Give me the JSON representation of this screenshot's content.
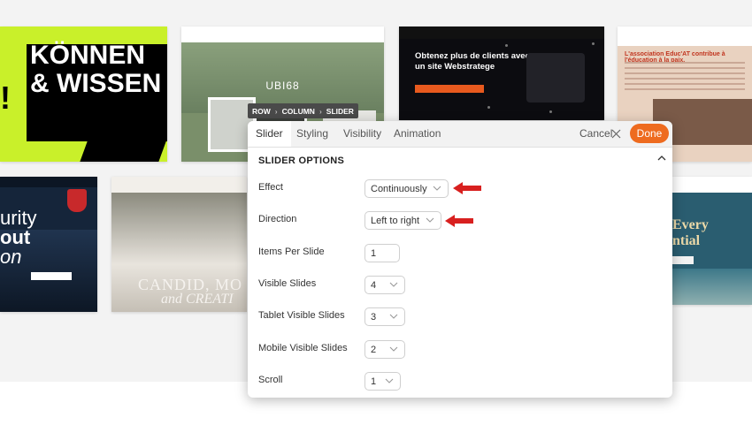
{
  "background": {
    "thumbnails": {
      "konnen": {
        "line1": "KÖNNEN",
        "line2": "& WISSEN",
        "mark": "!"
      },
      "ubi": {
        "logo": "UBI68"
      },
      "webstrat": {
        "headline": "Obtenez plus de clients avec un site Webstratege"
      },
      "educat": {
        "title": "L'association Educ'AT contribue à l'éducation à la paix."
      },
      "security": {
        "line1": "urity",
        "line2": "out",
        "line3": "on"
      },
      "wedding": {
        "line1": "CANDID, MO",
        "line2": "and CREATI"
      },
      "finance": {
        "line1": "Every",
        "line2": "ntial"
      }
    }
  },
  "breadcrumb": {
    "items": [
      "ROW",
      "COLUMN",
      "SLIDER"
    ],
    "separator": "›"
  },
  "panel": {
    "tabs": [
      {
        "label": "Slider",
        "active": true
      },
      {
        "label": "Styling",
        "active": false
      },
      {
        "label": "Visibility",
        "active": false
      },
      {
        "label": "Animation",
        "active": false
      }
    ],
    "cancel_label": "Cancel",
    "done_label": "Done",
    "section_title": "SLIDER OPTIONS",
    "fields": {
      "effect": {
        "label": "Effect",
        "value": "Continuously"
      },
      "direction": {
        "label": "Direction",
        "value": "Left to right"
      },
      "items_per_slide": {
        "label": "Items Per Slide",
        "value": "1"
      },
      "visible_slides": {
        "label": "Visible Slides",
        "value": "4"
      },
      "tablet_visible_slides": {
        "label": "Tablet Visible Slides",
        "value": "3"
      },
      "mobile_visible_slides": {
        "label": "Mobile Visible Slides",
        "value": "2"
      },
      "scroll": {
        "label": "Scroll",
        "value": "1"
      }
    }
  },
  "colors": {
    "accent": "#ee6b1f",
    "arrow": "#d8201f"
  }
}
